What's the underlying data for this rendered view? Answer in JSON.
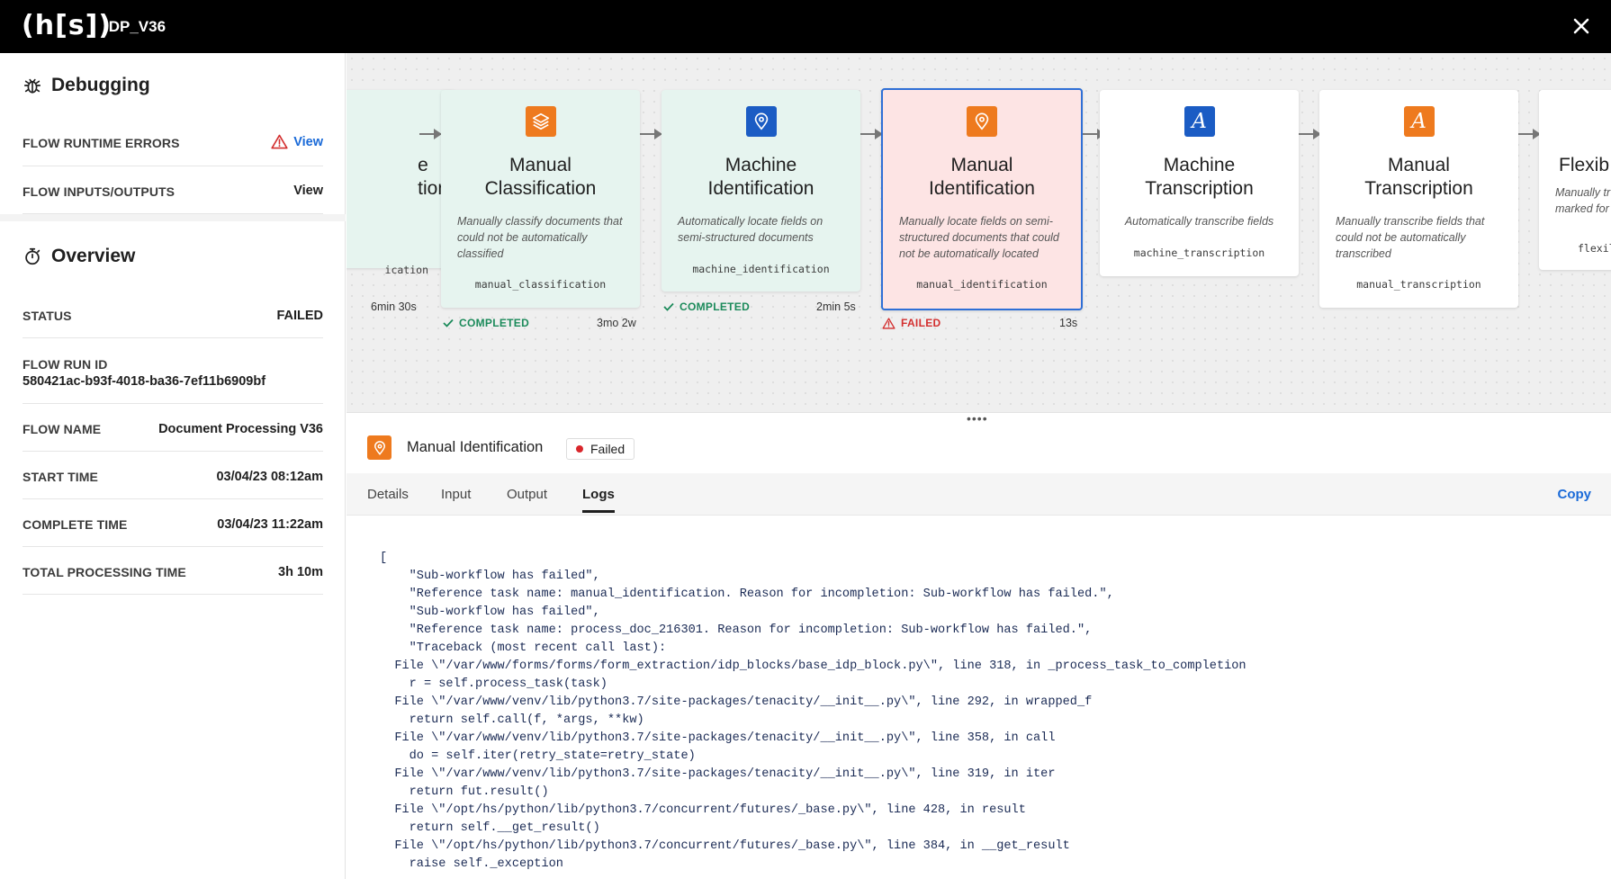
{
  "header": {
    "logo": "(h[s])",
    "title": "IDP_V36"
  },
  "debugging": {
    "title": "Debugging",
    "rows": [
      {
        "label": "FLOW RUNTIME ERRORS",
        "link": "View"
      },
      {
        "label": "FLOW INPUTS/OUTPUTS",
        "link": "View"
      }
    ]
  },
  "overview": {
    "title": "Overview",
    "status": {
      "label": "STATUS",
      "value": "FAILED"
    },
    "run_id": {
      "label": "FLOW RUN ID",
      "value": "580421ac-b93f-4018-ba36-7ef11b6909bf"
    },
    "flow_name": {
      "label": "FLOW NAME",
      "value": "Document Processing V36"
    },
    "start_time": {
      "label": "START TIME",
      "value": "03/04/23 08:12am"
    },
    "complete_time": {
      "label": "COMPLETE TIME",
      "value": "03/04/23 11:22am"
    },
    "total_time": {
      "label": "TOTAL PROCESSING TIME",
      "value": "3h 10m"
    }
  },
  "flow": {
    "blocks": [
      {
        "title_line1": "e",
        "title_line2": "tion",
        "code": "ication",
        "status": "",
        "duration": "6min 30s"
      },
      {
        "title_line1": "Manual",
        "title_line2": "Classification",
        "desc": "Manually classify documents that could not be automatically classified",
        "code": "manual_classification",
        "status": "COMPLETED",
        "duration": "3mo 2w"
      },
      {
        "title_line1": "Machine",
        "title_line2": "Identification",
        "desc": "Automatically locate fields on semi-structured documents",
        "code": "machine_identification",
        "status": "COMPLETED",
        "duration": "2min 5s"
      },
      {
        "title_line1": "Manual",
        "title_line2": "Identification",
        "desc": "Manually locate fields on semi-structured documents that could not be automatically located",
        "code": "manual_identification",
        "status": "FAILED",
        "duration": "13s"
      },
      {
        "title_line1": "Machine",
        "title_line2": "Transcription",
        "desc": "Automatically transcribe fields",
        "code": "machine_transcription"
      },
      {
        "title_line1": "Manual",
        "title_line2": "Transcription",
        "desc": "Manually transcribe fields that could not be automatically transcribed",
        "code": "manual_transcription"
      },
      {
        "title_line1": "Flexib",
        "desc_line1": "Manually tr",
        "desc_line2": "marked for",
        "code": "flexil"
      }
    ]
  },
  "splitter": {
    "handle": "••••"
  },
  "detail": {
    "icon": "location-pin-icon",
    "name": "Manual Identification",
    "badge": "Failed",
    "tabs": [
      "Details",
      "Input",
      "Output",
      "Logs"
    ],
    "copy_label": "Copy",
    "logs": "[\n    \"Sub-workflow has failed\",\n    \"Reference task name: manual_identification. Reason for incompletion: Sub-workflow has failed.\",\n    \"Sub-workflow has failed\",\n    \"Reference task name: process_doc_216301. Reason for incompletion: Sub-workflow has failed.\",\n    \"Traceback (most recent call last):\n  File \\\"/var/www/forms/forms/form_extraction/idp_blocks/base_idp_block.py\\\", line 318, in _process_task_to_completion\n    r = self.process_task(task)\n  File \\\"/var/www/venv/lib/python3.7/site-packages/tenacity/__init__.py\\\", line 292, in wrapped_f\n    return self.call(f, *args, **kw)\n  File \\\"/var/www/venv/lib/python3.7/site-packages/tenacity/__init__.py\\\", line 358, in call\n    do = self.iter(retry_state=retry_state)\n  File \\\"/var/www/venv/lib/python3.7/site-packages/tenacity/__init__.py\\\", line 319, in iter\n    return fut.result()\n  File \\\"/opt/hs/python/lib/python3.7/concurrent/futures/_base.py\\\", line 428, in result\n    return self.__get_result()\n  File \\\"/opt/hs/python/lib/python3.7/concurrent/futures/_base.py\\\", line 384, in __get_result\n    raise self._exception"
  },
  "colors": {
    "accent": "#1a6ad8",
    "failed": "#d32f2f",
    "completed": "#1b8a5a",
    "orange_icon": "#ee7a1e",
    "blue_icon": "#1b5cc4"
  }
}
